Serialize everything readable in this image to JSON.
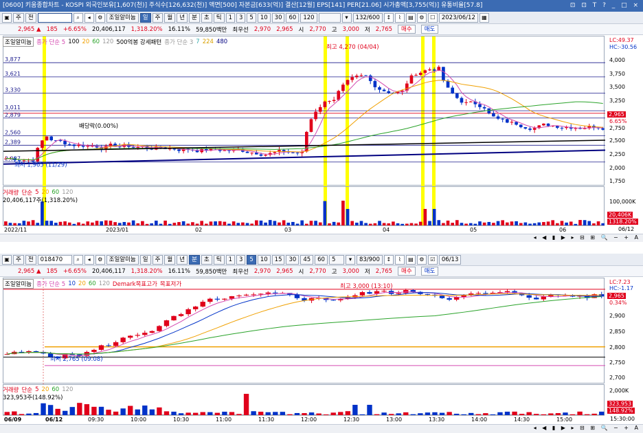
{
  "window": {
    "title": "[0600] 키움종합차트 - KOSPI 외국인보유[1,607(천)] 주식수[126,632(천)] 액면[500] 자본금[633(억)] 결산[12월] EPS[141] PER[21.06] 시가총액[3,755(억)] 유통비율[57.8]",
    "controls": "⊡ ⊡ T ? _ □ ×"
  },
  "top": {
    "toolbar": {
      "period_a": "주",
      "period_b": "전",
      "code": "018470",
      "name": "조일알미늄",
      "tabs": [
        "일",
        "주",
        "월",
        "년",
        "분",
        "초",
        "틱"
      ],
      "selected_tab": "일",
      "nums": [
        "1",
        "3",
        "5",
        "10",
        "30",
        "60",
        "120"
      ],
      "count": "132/600",
      "date": "2023/06/12"
    },
    "info": {
      "price": "2,965",
      "arrow": "▲",
      "change": "185",
      "pct": "+6.65%",
      "volume": "20,406,117",
      "vol_pct": "1,318.20%",
      "turnover": "16.11%",
      "amount": "59,850백만",
      "prio": "최우선",
      "ask": "2,970",
      "bid": "2,965",
      "open_l": "시",
      "open": "2,770",
      "high_l": "고",
      "high": "3,000",
      "low_l": "저",
      "low": "2,765",
      "buy": "매수",
      "sell": "매도"
    },
    "legend": [
      "조일알미늄",
      "종가 단순 5",
      "100",
      "20",
      "60",
      "120",
      "500억봉 강세패턴",
      "종가 단순 3",
      "7",
      "224",
      "480"
    ],
    "annot": {
      "max": "최고 4,270 (04/04)",
      "min": "최저 1,965 (11/29)",
      "div": "배당락(0.00%)"
    },
    "prices": [
      "3,877",
      "3,621",
      "3,330",
      "3,011",
      "2,879",
      "2,560",
      "2,389",
      "2,087"
    ],
    "axis": [
      "4,000",
      "3,750",
      "3,500",
      "3,250",
      "3,000",
      "2,750",
      "2,500",
      "2,250",
      "2,000",
      "1,750"
    ],
    "axis_top": [
      "LC:49.37",
      "HC:-30.56"
    ],
    "cur_price": "2,965",
    "cur_pct": "6.65%",
    "vol_legend": [
      "거래량",
      "단순",
      "5",
      "20",
      "60",
      "120"
    ],
    "vol_val": "20,406,117주(1,318.20%)",
    "vol_axis": "100,000K",
    "vol_cur": [
      "20,406K",
      "1318.20%"
    ],
    "xlabels": [
      "2022/11",
      "2023/01",
      "02",
      "03",
      "04",
      "05",
      "06"
    ],
    "xend": "06/12"
  },
  "bottom": {
    "toolbar": {
      "period_a": "주",
      "period_b": "전",
      "code": "018470",
      "name": "조일알미늄",
      "tabs": [
        "일",
        "주",
        "월",
        "년",
        "분",
        "초",
        "틱"
      ],
      "selected_tab": "분",
      "nums": [
        "1",
        "3",
        "5",
        "10",
        "15",
        "30",
        "45",
        "60"
      ],
      "sel_num": "5",
      "count": "83/900",
      "date": "06/13"
    },
    "info": {
      "price": "2,965",
      "arrow": "▲",
      "change": "185",
      "pct": "+6.65%",
      "volume": "20,406,117",
      "vol_pct": "1,318.20%",
      "turnover": "16.11%",
      "amount": "59,850백만",
      "prio": "최우선",
      "ask": "2,970",
      "bid": "2,965",
      "open_l": "시",
      "open": "2,770",
      "high_l": "고",
      "high": "3,000",
      "low_l": "저",
      "low": "2,765",
      "buy": "매수",
      "sell": "매도"
    },
    "legend": [
      "조일알미늄",
      "종가 단순 5",
      "10",
      "20",
      "60",
      "120",
      "Demark목표고가",
      "목표저가"
    ],
    "annot": {
      "max": "최고 3,000 (13:10)",
      "min": "최저 2,765 (09:08)"
    },
    "axis": [
      "2,950",
      "2,900",
      "2,850",
      "2,800",
      "2,750",
      "2,700"
    ],
    "axis_top": [
      "LC:7.23",
      "HC:-1.17"
    ],
    "cur_price": "2,965",
    "cur_pct": "0.34%",
    "vol_legend": [
      "거래량",
      "단순",
      "5",
      "20",
      "60",
      "120"
    ],
    "vol_val": "323,953주(148.92%)",
    "vol_axis": "2,000K",
    "vol_cur": [
      "323,953",
      "148.92%"
    ],
    "xlabels": [
      "06/09",
      "06/12",
      "09:30",
      "10:00",
      "10:30",
      "11:00",
      "11:30",
      "12:00",
      "12:30",
      "13:00",
      "13:30",
      "14:00",
      "14:30",
      "15:00"
    ],
    "xend": "15:30:00"
  },
  "colors": {
    "up": "#e0001b",
    "down": "#0032c8",
    "highlight": "#ffff00",
    "ma5": "#d44ab0",
    "ma20": "#f0a000",
    "ma60": "#2aa32a",
    "ma120": "#999999"
  }
}
